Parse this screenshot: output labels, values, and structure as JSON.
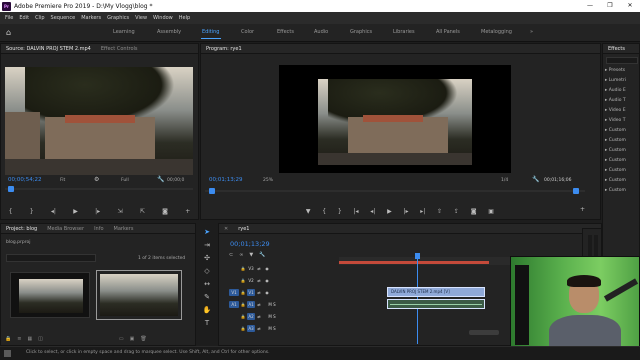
{
  "window": {
    "title": "Adobe Premiere Pro 2019 - D:\\My Vlogg\\blog *",
    "app_badge": "Pr",
    "controls": [
      "—",
      "❐",
      "✕"
    ]
  },
  "menu": [
    "File",
    "Edit",
    "Clip",
    "Sequence",
    "Markers",
    "Graphics",
    "View",
    "Window",
    "Help"
  ],
  "workspaces": [
    "Learning",
    "Assembly",
    "Editing",
    "Color",
    "Effects",
    "Audio",
    "Graphics",
    "Libraries",
    "All Panels",
    "Metalogging"
  ],
  "workspace_active": "Editing",
  "source_panel": {
    "tabs": [
      "Source: DALVIN PROJ STEM 2.mp4",
      "Effect Controls"
    ],
    "timecode": "00;00;54;22",
    "fit": "Fit",
    "quality": "Full",
    "end_timecode": "00;00;0"
  },
  "program_panel": {
    "tab": "Program: rye1",
    "timecode": "00;01;13;29",
    "zoom": "25%",
    "fraction": "1/4",
    "duration": "00;01;16;06"
  },
  "project_panel": {
    "tabs": [
      "Project: blog",
      "Media Browser",
      "Info",
      "Markers"
    ],
    "file": "blog.prproj",
    "selection_info": "1 of 2 items selected"
  },
  "timeline": {
    "tab": "rye1",
    "timecode": "00;01;13;29",
    "tracks": [
      {
        "src": "",
        "name": "V3",
        "label": ""
      },
      {
        "src": "",
        "name": "V2",
        "label": ""
      },
      {
        "src": "V1",
        "name": "V1",
        "label": ""
      },
      {
        "src": "A1",
        "name": "A1",
        "label": "M  S"
      },
      {
        "src": "",
        "name": "A2",
        "label": "M  S"
      },
      {
        "src": "",
        "name": "A3",
        "label": "M  S"
      }
    ],
    "clip_label": "DALVIN PROJ STEM 2.mp4 [V]"
  },
  "effects_panel": {
    "tab": "Effects",
    "items": [
      "Presets",
      "Lumetri",
      "Audio E",
      "Audio T",
      "Video E",
      "Video T",
      "Custom",
      "Custom",
      "Custom",
      "Custom",
      "Custom",
      "Custom",
      "Custom"
    ]
  },
  "status_bar": {
    "text": "Click to select, or click in empty space and drag to marquee select. Use Shift, Alt, and Ctrl for other options."
  },
  "colors": {
    "accent": "#3c8cf0",
    "panel_bg": "#232323",
    "clip_video": "#8fa9d8",
    "work_area": "#c44a3a"
  }
}
